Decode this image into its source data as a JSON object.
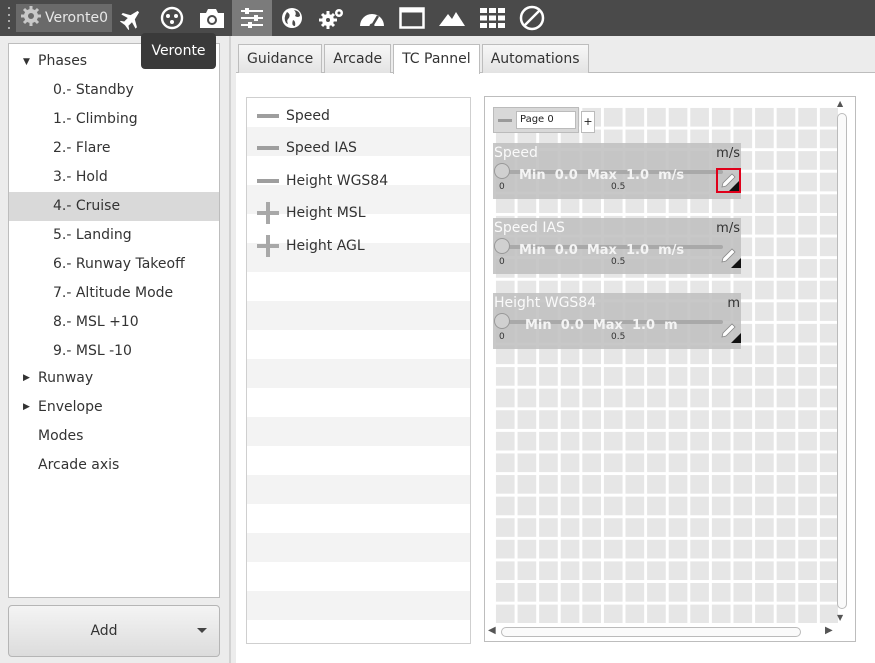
{
  "toolbar": {
    "app_name": "Veronte0",
    "icons": [
      "gear-icon",
      "airplane-icon",
      "joystick-icon",
      "camera-icon",
      "sliders-icon",
      "globe-icon",
      "gears-icon",
      "gauge-icon",
      "window-icon",
      "mountain-icon",
      "grid-icon",
      "disabled-icon"
    ],
    "active_icon": "sliders-icon"
  },
  "tooltip": {
    "text": "Veronte"
  },
  "tree": {
    "phases_label": "Phases",
    "phases": [
      "0.- Standby",
      "1.- Climbing",
      "2.- Flare",
      "3.- Hold",
      "4.- Cruise",
      "5.- Landing",
      "6.- Runway Takeoff",
      "7.- Altitude Mode",
      "8.- MSL +10",
      "9.- MSL -10"
    ],
    "selected_phase": "4.- Cruise",
    "runway_label": "Runway",
    "envelope_label": "Envelope",
    "modes_label": "Modes",
    "arcade_axis_label": "Arcade axis"
  },
  "add_button": {
    "label": "Add"
  },
  "tabs": [
    "Guidance",
    "Arcade",
    "TC Pannel",
    "Automations"
  ],
  "active_tab": "TC Pannel",
  "variables": [
    {
      "name": "Speed",
      "symbol": "minus"
    },
    {
      "name": "Speed IAS",
      "symbol": "minus"
    },
    {
      "name": "Height WGS84",
      "symbol": "minus"
    },
    {
      "name": "Height MSL",
      "symbol": "plus"
    },
    {
      "name": "Height AGL",
      "symbol": "plus"
    }
  ],
  "page": {
    "name": "Page 0",
    "add_label": "+"
  },
  "widgets": [
    {
      "title": "Speed",
      "unit": "m/s",
      "min_label": "Min",
      "min": "0.0",
      "max_label": "Max",
      "max": "1.0",
      "stat_unit": "m/s",
      "tick_start": "0",
      "tick_mid": "0.5",
      "edit_highlighted": true
    },
    {
      "title": "Speed IAS",
      "unit": "m/s",
      "min_label": "Min",
      "min": "0.0",
      "max_label": "Max",
      "max": "1.0",
      "stat_unit": "m/s",
      "tick_start": "0",
      "tick_mid": "0.5",
      "edit_highlighted": false
    },
    {
      "title": "Height WGS84",
      "unit": "m",
      "min_label": "Min",
      "min": "0.0",
      "max_label": "Max",
      "max": "1.0",
      "stat_unit": "m",
      "tick_start": "0",
      "tick_mid": "0.5",
      "edit_highlighted": false
    }
  ],
  "colors": {
    "toolbar_bg": "#4a4a4a",
    "highlight": "#e0001a",
    "selected_row": "#d9d9d9"
  }
}
